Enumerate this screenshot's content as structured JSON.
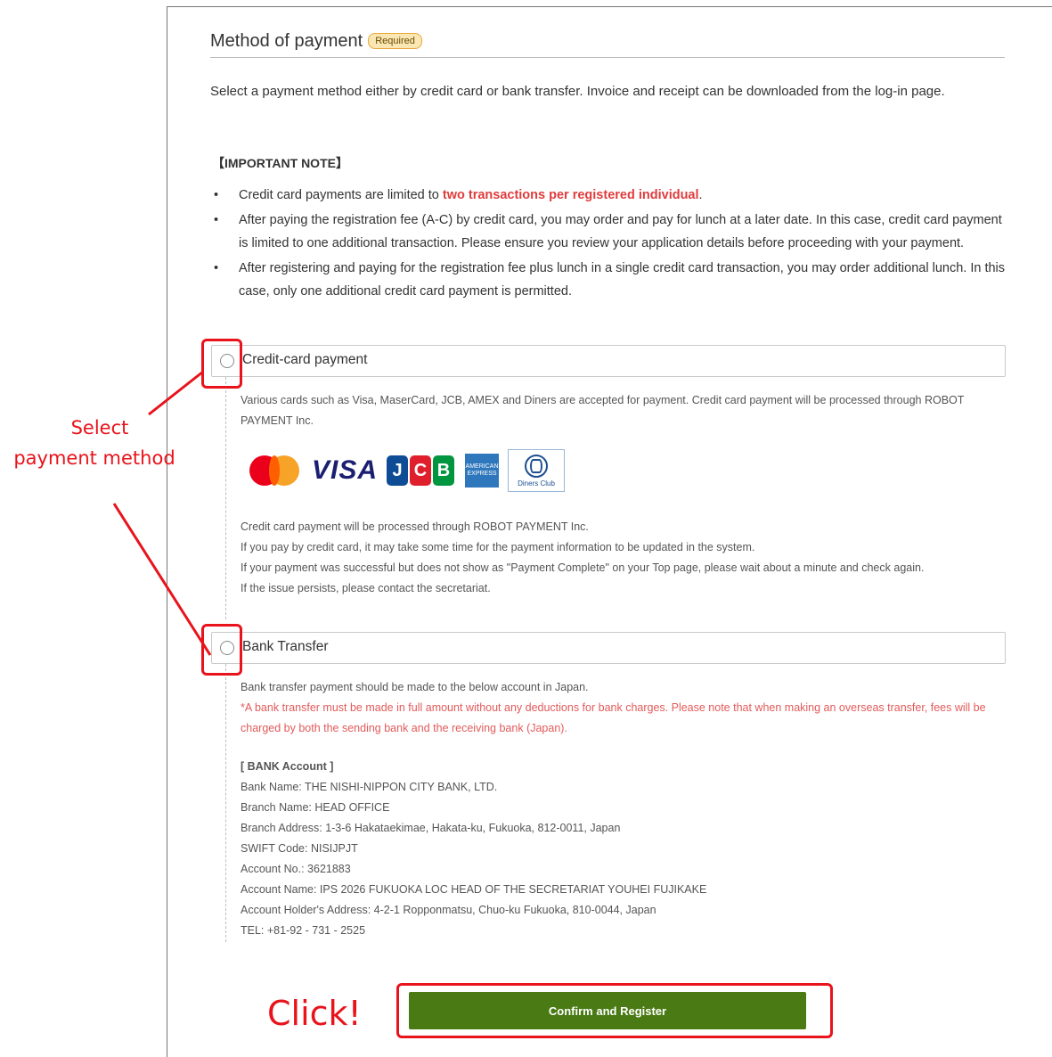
{
  "section": {
    "title": "Method of payment",
    "required_badge": "Required",
    "intro": "Select a payment method either by credit card or bank transfer. Invoice and receipt can be downloaded from the log-in page.",
    "note_heading": "【IMPORTANT NOTE】",
    "notes": [
      {
        "before": "Credit card payments are limited to ",
        "highlight": "two transactions per registered individual",
        "after": "."
      },
      {
        "text": "After paying the registration fee (A-C) by credit card, you may order and pay for lunch at a later date. In this case, credit card payment is limited to one additional transaction. Please ensure you review your application details before proceeding with your payment."
      },
      {
        "text": "After registering and paying for the registration fee plus lunch in a single credit card transaction, you may order additional lunch. In this case, only one additional credit card payment is permitted."
      }
    ]
  },
  "options": {
    "credit": {
      "label": "Credit-card payment",
      "desc_top": "Various cards such as Visa, MaserCard, JCB, AMEX and Diners are accepted for payment. Credit card payment will be processed through ROBOT PAYMENT Inc.",
      "logos": {
        "visa": "VISA",
        "jcb": [
          "J",
          "C",
          "B"
        ],
        "amex": "AMERICAN EXPRESS",
        "diners": "Diners Club"
      },
      "desc_bottom": [
        "Credit card payment will be processed through ROBOT PAYMENT Inc.",
        "If you pay by credit card, it may take some time for the payment information to be updated in the system.",
        "If your payment was successful but does not show as \"Payment Complete\" on your Top page, please wait about a minute and check again.",
        "If the issue persists, please contact the secretariat."
      ]
    },
    "bank": {
      "label": "Bank Transfer",
      "desc_intro": "Bank transfer payment should be made to the below account in Japan.",
      "desc_warning": "*A bank transfer must be made in full amount without any deductions for bank charges. Please note that when making an overseas transfer, fees will be charged by both the sending bank and the receiving bank (Japan).",
      "account_heading": "[ BANK Account ]",
      "account_lines": [
        "Bank Name: THE NISHI-NIPPON CITY BANK, LTD.",
        "Branch Name: HEAD OFFICE",
        "Branch Address: 1-3-6 Hakataekimae, Hakata-ku, Fukuoka, 812-0011, Japan",
        "SWIFT Code: NISIJPJT",
        "Account No.: 3621883",
        "Account Name: IPS 2026 FUKUOKA LOC HEAD OF THE SECRETARIAT YOUHEI FUJIKAKE",
        "Account Holder's Address: 4-2-1 Ropponmatsu, Chuo-ku Fukuoka, 810-0044, Japan",
        "TEL: +81-92 - 731 - 2525"
      ]
    }
  },
  "confirm_button": "Confirm and Register",
  "annotations": {
    "select_line1": "Select",
    "select_line2": "payment method",
    "click": "Click!"
  },
  "colors": {
    "accent_red": "#e8131b",
    "button_green": "#4a7a14",
    "warning_red": "#e35a5a"
  }
}
